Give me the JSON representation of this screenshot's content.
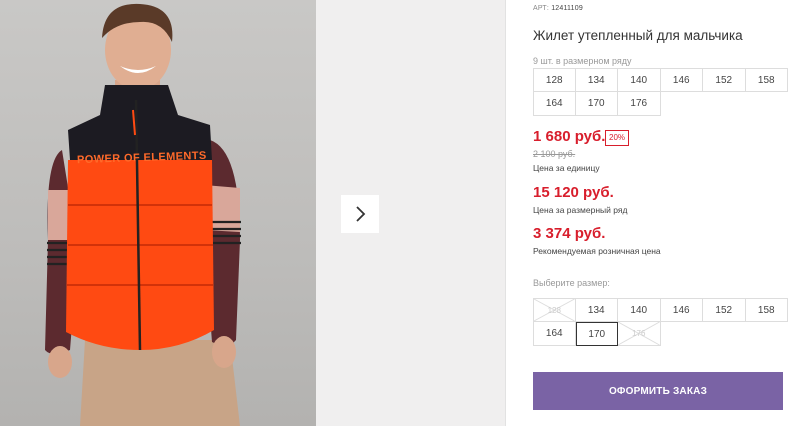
{
  "product": {
    "art_label": "АРТ:",
    "art_number": "12411109",
    "title": "Жилет утепленный для мальчика",
    "size_row_note": "9 шт. в размерном ряду",
    "size_row": [
      "128",
      "134",
      "140",
      "146",
      "152",
      "158",
      "164",
      "170",
      "176"
    ],
    "price": "1 680 руб.",
    "discount_badge": "20%",
    "old_price": "2 100 руб.",
    "price_unit_label": "Цена за единицу",
    "row_price": "15 120 руб.",
    "row_price_label": "Цена за размерный ряд",
    "retail_price": "3 374 руб.",
    "retail_price_label": "Рекомендуемая розничная цена",
    "vest_print_text": "POWER OF ELEMENTS"
  },
  "size_picker": {
    "label": "Выберите размер:",
    "sizes": [
      {
        "label": "128",
        "state": "disabled"
      },
      {
        "label": "134",
        "state": "available"
      },
      {
        "label": "140",
        "state": "available"
      },
      {
        "label": "146",
        "state": "available"
      },
      {
        "label": "152",
        "state": "available"
      },
      {
        "label": "158",
        "state": "available"
      },
      {
        "label": "164",
        "state": "available"
      },
      {
        "label": "170",
        "state": "selected"
      },
      {
        "label": "176",
        "state": "disabled"
      }
    ]
  },
  "actions": {
    "order_label": "ОФОРМИТЬ ЗАКАЗ",
    "next_icon": "chevron-right-icon"
  },
  "colors": {
    "price_red": "#d81e2c",
    "order_button": "#7a63a5",
    "vest_orange": "#ff4a12"
  }
}
